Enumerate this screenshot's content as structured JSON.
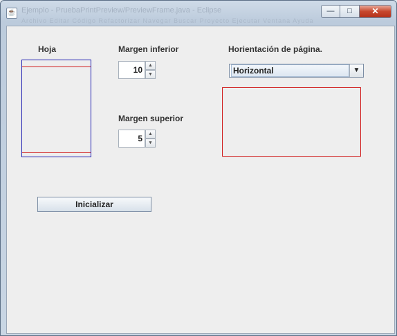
{
  "window": {
    "title": "Ejemplo - PruebaPrintPreview/PreviewFrame.java - Eclipse",
    "menu_ghost": "Archivo  Editar  Código  Refactorizar  Navegar  Buscar  Proyecto  Ejecutar  Ventana  Ayuda",
    "minimize_glyph": "—",
    "maximize_glyph": "□",
    "close_glyph": "✕",
    "app_icon_glyph": "☕"
  },
  "sheet": {
    "label": "Hoja"
  },
  "margen_inferior": {
    "label": "Margen inferior",
    "value": "10",
    "up_glyph": "▲",
    "down_glyph": "▼"
  },
  "margen_superior": {
    "label": "Margen superior",
    "value": "5",
    "up_glyph": "▲",
    "down_glyph": "▼"
  },
  "orientacion": {
    "label": "Horientación de página.",
    "selected": "Horizontal",
    "arrow_glyph": "▼"
  },
  "inicializar_button": {
    "label": "Inicializar"
  },
  "colors": {
    "sheet_border": "#1b1bb0",
    "margin_line": "#d01c1c",
    "preview_border": "#d01c1c",
    "panel_bg": "#eeeeee"
  }
}
